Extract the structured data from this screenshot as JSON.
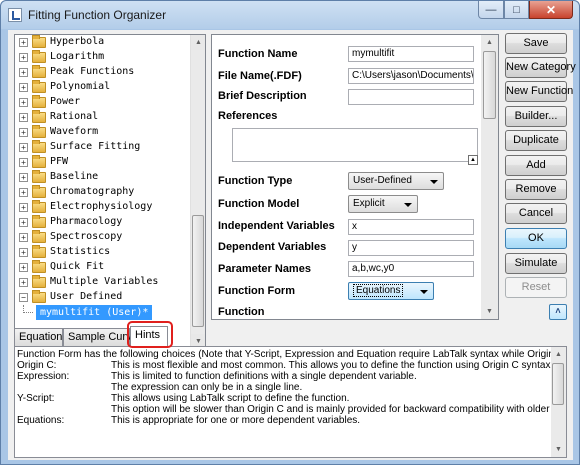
{
  "window": {
    "title": "Fitting Function Organizer",
    "minimize_glyph": "—",
    "maximize_glyph": "□",
    "close_glyph": "✕"
  },
  "tree": {
    "folders": [
      "Hyperbola",
      "Logarithm",
      "Peak Functions",
      "Polynomial",
      "Power",
      "Rational",
      "Waveform",
      "Surface Fitting",
      "PFW",
      "Baseline",
      "Chromatography",
      "Electrophysiology",
      "Pharmacology",
      "Spectroscopy",
      "Statistics",
      "Quick Fit",
      "Multiple Variables",
      "User Defined"
    ],
    "expand_glyph": "+",
    "collapse_glyph": "−",
    "selected_item": "mymultifit (User)*"
  },
  "properties": {
    "function_name_label": "Function Name",
    "function_name_value": "mymultifit",
    "file_name_label": "File Name(.FDF)",
    "file_name_value": "C:\\Users\\jason\\Documents\\(",
    "brief_description_label": "Brief Description",
    "brief_description_value": "",
    "references_label": "References",
    "references_value": "",
    "function_type_label": "Function Type",
    "function_type_value": "User-Defined",
    "function_model_label": "Function Model",
    "function_model_value": "Explicit",
    "independent_variables_label": "Independent Variables",
    "independent_variables_value": "x",
    "dependent_variables_label": "Dependent Variables",
    "dependent_variables_value": "y",
    "parameter_names_label": "Parameter Names",
    "parameter_names_value": "a,b,wc,y0",
    "function_form_label": "Function Form",
    "function_form_value": "Equations",
    "function_label": "Function"
  },
  "buttons": {
    "save": "Save",
    "new_category": "New Category",
    "new_function": "New Function",
    "builder": "Builder...",
    "duplicate": "Duplicate",
    "add": "Add",
    "remove": "Remove",
    "cancel": "Cancel",
    "ok": "OK",
    "simulate": "Simulate",
    "reset": "Reset",
    "collapse_glyph": "˄"
  },
  "tabs": [
    "Equation",
    "Sample Curve",
    "Hints"
  ],
  "active_tab": "Hints",
  "hints": {
    "intro": "Function Form has the following choices (Note that Y-Script, Expression and Equation require LabTalk syntax while OriginC requi",
    "rows": [
      {
        "key": "Origin C:",
        "value": "This is most flexible and most common. This allows you to define the function using Origin C syntax"
      },
      {
        "key": "Expression:",
        "value": "This is limited to function definitions with a single dependent variable."
      },
      {
        "key": "",
        "value": "The expression can only be in a single line."
      },
      {
        "key": "Y-Script:",
        "value": "This allows using LabTalk script to define the function."
      },
      {
        "key": "",
        "value": "This option will be slower than Origin C and is mainly provided for backward compatibility with older versions."
      },
      {
        "key": "Equations:",
        "value": "This is appropriate for one or more dependent variables."
      }
    ]
  },
  "colors": {
    "selection": "#3399ff",
    "highlight_ring": "#e0201d",
    "title_bar": "#b3cde9",
    "close_button": "#c8432d"
  }
}
